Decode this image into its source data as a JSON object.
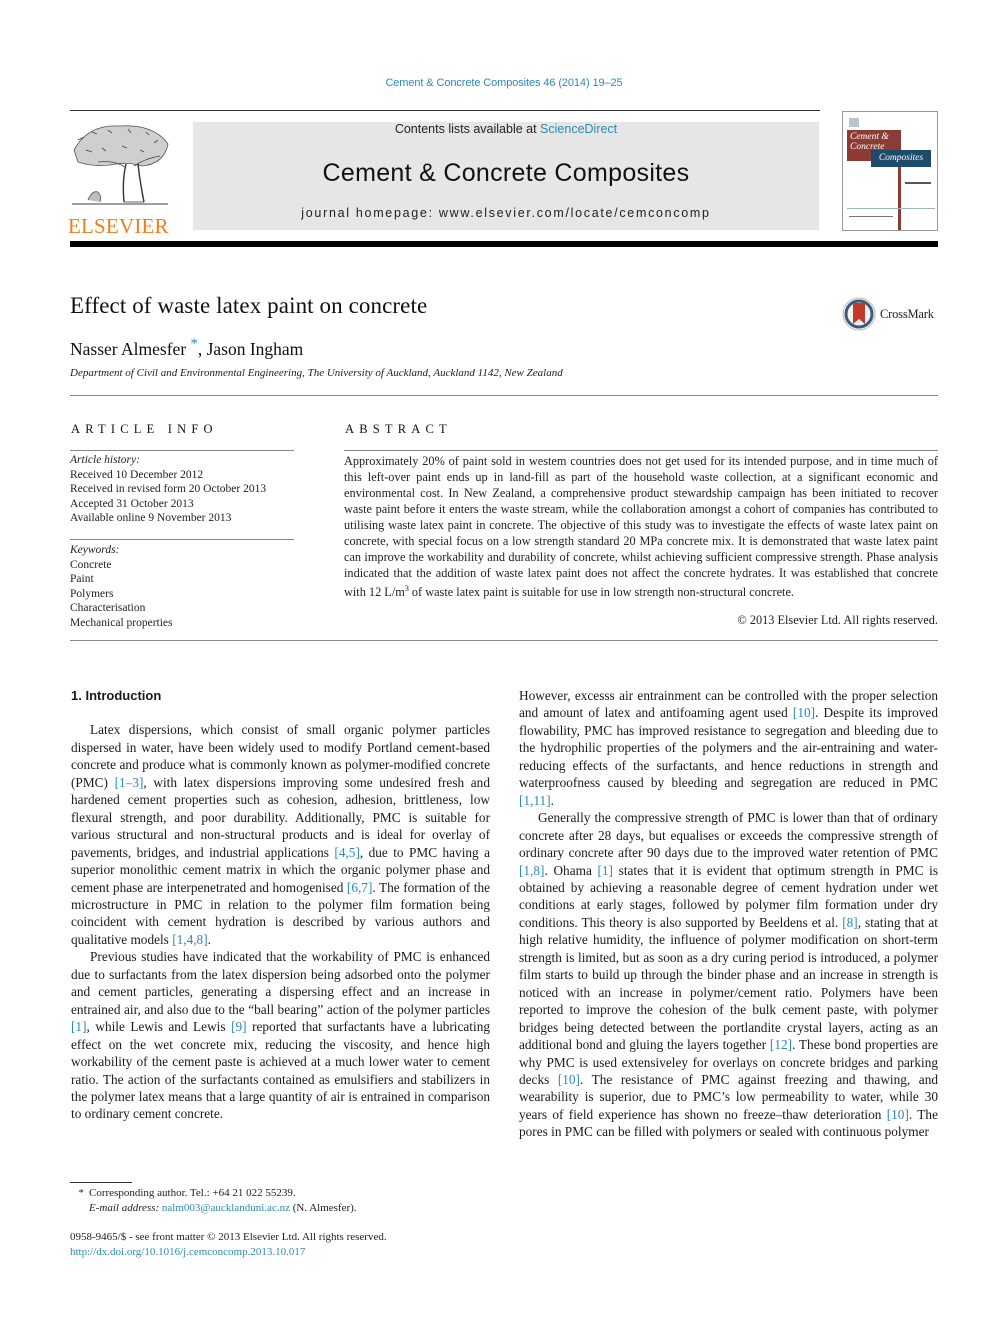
{
  "header": {
    "citation": "Cement & Concrete Composites 46 (2014) 19–25",
    "contents_prefix": "Contents lists available at ",
    "contents_link": "ScienceDirect",
    "journal_title": "Cement & Concrete Composites",
    "homepage": "journal homepage: www.elsevier.com/locate/cemconcomp",
    "publisher_logo": "ELSEVIER",
    "cover": {
      "title_line1": "Cement &",
      "title_line2": "Concrete",
      "title_line3": "Composites",
      "accent_red": "#8c3b35",
      "accent_blue": "#1e4a6b"
    },
    "colors": {
      "link": "#2a8ab8",
      "elsevier_orange": "#f07d1a",
      "masthead_bg": "#e6e6e6"
    }
  },
  "article": {
    "title": "Effect of waste latex paint on concrete",
    "authors": [
      {
        "name": "Nasser Almesfer",
        "mark": "*"
      },
      {
        "name": "Jason Ingham",
        "mark": ""
      }
    ],
    "author_separator": ", ",
    "affiliation": "Department of Civil and Environmental Engineering, The University of Auckland, Auckland 1142, New Zealand",
    "crossmark_label": "CrossMark"
  },
  "article_info": {
    "heading": "ARTICLE INFO",
    "history_label": "Article history:",
    "history": [
      "Received 10 December 2012",
      "Received in revised form 20 October 2013",
      "Accepted 31 October 2013",
      "Available online 9 November 2013"
    ],
    "keywords_label": "Keywords:",
    "keywords": [
      "Concrete",
      "Paint",
      "Polymers",
      "Characterisation",
      "Mechanical properties"
    ]
  },
  "abstract": {
    "heading": "ABSTRACT",
    "text_before_sup": "Approximately 20% of paint sold in westem countries does not get used for its intended purpose, and in time much of this left-over paint ends up in land-fill as part of the household waste collection, at a significant economic and environmental cost. In New Zealand, a comprehensive product stewardship campaign has been initiated to recover waste paint before it enters the waste stream, while the collaboration amongst a cohort of companies has contributed to utilising waste latex paint in concrete. The objective of this study was to investigate the effects of waste latex paint on concrete, with special focus on a low strength standard 20 MPa concrete mix. It is demonstrated that waste latex paint can improve the workability and durability of concrete, whilst achieving sufficient compressive strength. Phase analysis indicated that the addition of waste latex paint does not affect the concrete hydrates. It was established that concrete with 12 L/m",
    "sup": "3",
    "text_after_sup": " of waste latex paint is suitable for use in low strength non-structural concrete.",
    "copyright": "© 2013 Elsevier Ltd. All rights reserved."
  },
  "body": {
    "section_heading": "1. Introduction",
    "left_paragraphs": [
      [
        {
          "t": "Latex dispersions, which consist of small organic polymer parti­cles dispersed in water, have been widely used to modify Portland cement-based concrete and produce what is commonly known as polymer-modified concrete (PMC) "
        },
        {
          "ref": "[1–3]"
        },
        {
          "t": ", with latex dispersions improving some undesired fresh and hardened cement properties such as cohesion, adhesion, brittleness, low flexural strength, and poor durability. Additionally, PMC is suitable for various structural and non-structural products and is ideal for overlay of pavements, bridges, and industrial applications "
        },
        {
          "ref": "[4,5]"
        },
        {
          "t": ", due to PMC having a superior monolithic cement matrix in which the organic polymer phase and cement phase are interpenetrated and homogenised "
        },
        {
          "ref": "[6,7]"
        },
        {
          "t": ". The formation of the microstructure in PMC in relation to the polymer film formation being coincident with cement hydra­tion is described by various authors and qualitative models "
        },
        {
          "ref": "[1,4,8]"
        },
        {
          "t": "."
        }
      ],
      [
        {
          "t": "Previous studies have indicated that the workability of PMC is enhanced due to surfactants from the latex dispersion being ad­sorbed onto the polymer and cement particles, generating a dis­persing effect and an increase in entrained air, and also due to the “ball bearing” action of the polymer particles "
        },
        {
          "ref": "[1]"
        },
        {
          "t": ", while Lewis and Lewis "
        },
        {
          "ref": "[9]"
        },
        {
          "t": " reported that surfactants have a lubricating effect on the wet concrete mix, reducing the viscosity, and hence high workability of the cement paste is achieved at a much lower water to cement ratio. The action of the surfactants contained as emulsi­fiers and stabilizers in the polymer latex means that a large quan­tity of air is entrained in comparison to ordinary cement concrete."
        }
      ]
    ],
    "right_paragraphs": [
      [
        {
          "t": "However, excesss air entrainment can be controlled with the prop­er selection and amount of latex and antifoaming agent used "
        },
        {
          "ref": "[10]"
        },
        {
          "t": ". Despite its improved flowability, PMC has improved resistance to segregation and bleeding due to the hydrophilic properties of the polymers and the air-entraining and water-reducing effects of the surfactants, and hence reductions in strength and waterproof­ness caused by bleeding and segregation are reduced in PMC "
        },
        {
          "ref": "[1,11]"
        },
        {
          "t": "."
        }
      ],
      [
        {
          "t": "Generally the compressive strength of PMC is lower than that of ordinary concrete after 28 days, but equalises or exceeds the com­pressive strength of ordinary concrete after 90 days due to the im­proved water retention of PMC "
        },
        {
          "ref": "[1,8]"
        },
        {
          "t": ". Ohama "
        },
        {
          "ref": "[1]"
        },
        {
          "t": " states that it is evident that optimum strength in PMC is obtained by achieving a reasonable degree of cement hydration under wet conditions at early stages, followed by polymer film formation under dry condi­tions. This theory is also supported by Beeldens et al. "
        },
        {
          "ref": "[8]"
        },
        {
          "t": ", stating that at high relative humidity, the influence of polymer modifica­tion on short-term strength is limited, but as soon as a dry curing period is introduced, a polymer film starts to build up through the binder phase and an increase in strength is noticed with an in­crease in polymer/cement ratio. Polymers have been reported to improve the cohesion of the bulk cement paste, with polymer bridges being detected between the portlandite crystal layers, act­ing as an additional bond and gluing the layers together "
        },
        {
          "ref": "[12]"
        },
        {
          "t": ". These bond properties are why PMC is used extensiveley for overlays on concrete bridges and parking decks "
        },
        {
          "ref": "[10]"
        },
        {
          "t": ". The resistance of PMC against freezing and thawing, and wearability is superior, due to PMC’s low permeability to water, while 30 years of field experience has shown no freeze–thaw deterioration "
        },
        {
          "ref": "[10]"
        },
        {
          "t": ". The pores in PMC can be filled with polymers or sealed with continuous polymer"
        }
      ]
    ]
  },
  "footnotes": {
    "star": "*",
    "corresponding": "Corresponding author. Tel.: +64 21 022 55239.",
    "email_label": "E-mail address:",
    "email": "nalm003@aucklanduni.ac.nz",
    "email_suffix": " (N. Almesfer).",
    "issn_line": "0958-9465/$ - see front matter © 2013 Elsevier Ltd. All rights reserved.",
    "doi": "http://dx.doi.org/10.1016/j.cemconcomp.2013.10.017"
  }
}
